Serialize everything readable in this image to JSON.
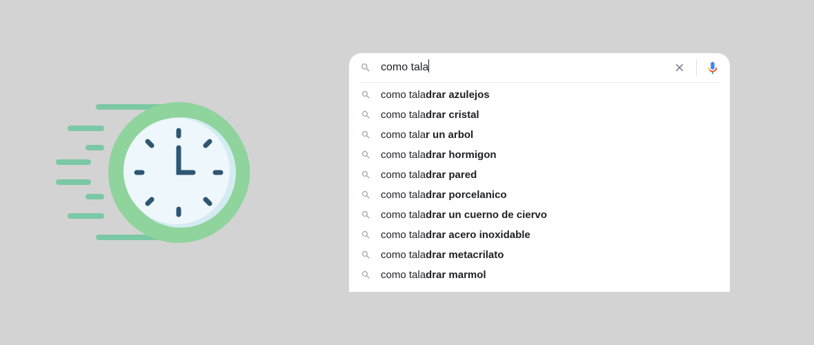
{
  "search": {
    "query": "como tala",
    "suggestions": [
      {
        "prefix": "como tala",
        "completion": "drar azulejos"
      },
      {
        "prefix": "como tala",
        "completion": "drar cristal"
      },
      {
        "prefix": "como tala",
        "completion": "r un arbol"
      },
      {
        "prefix": "como tala",
        "completion": "drar hormigon"
      },
      {
        "prefix": "como tala",
        "completion": "drar pared"
      },
      {
        "prefix": "como tala",
        "completion": "drar porcelanico"
      },
      {
        "prefix": "como tala",
        "completion": "drar un cuerno de ciervo"
      },
      {
        "prefix": "como tala",
        "completion": "drar acero inoxidable"
      },
      {
        "prefix": "como tala",
        "completion": "drar metacrilato"
      },
      {
        "prefix": "como tala",
        "completion": "drar marmol"
      }
    ]
  },
  "icons": {
    "search": "search-icon",
    "clear": "close-icon",
    "voice": "microphone-icon",
    "illustration": "fast-clock-icon"
  },
  "colors": {
    "background": "#d3d3d3",
    "clock_ring": "#8fd39d",
    "clock_shadow": "#7bc8a4",
    "clock_face": "#eef7fb",
    "clock_hands": "#2f5672"
  }
}
